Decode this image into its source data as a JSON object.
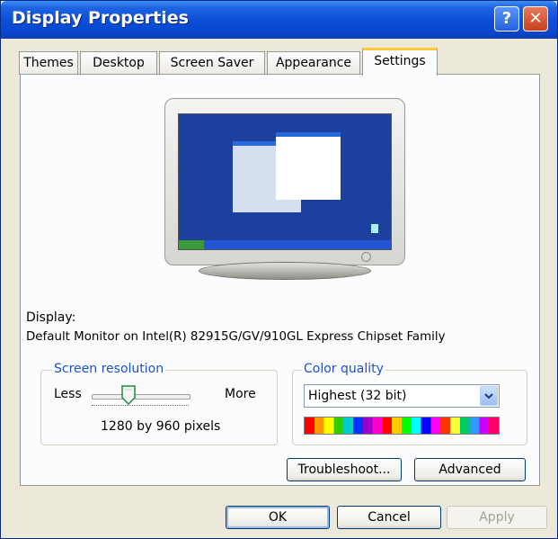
{
  "window": {
    "title": "Display Properties",
    "help_label": "?",
    "close_label": "✕"
  },
  "tabs": [
    {
      "label": "Themes"
    },
    {
      "label": "Desktop"
    },
    {
      "label": "Screen Saver"
    },
    {
      "label": "Appearance"
    },
    {
      "label": "Settings",
      "active": true
    }
  ],
  "settings": {
    "display_label": "Display:",
    "display_value": "Default Monitor on Intel(R) 82915G/GV/910GL Express Chipset Family",
    "screen_resolution": {
      "title": "Screen resolution",
      "less_label": "Less",
      "more_label": "More",
      "value": "1280 by 960 pixels",
      "slider_level": 0.38
    },
    "color_quality": {
      "title": "Color quality",
      "selected": "Highest (32 bit)",
      "swatch_colors": [
        "#ff0000",
        "#ff9900",
        "#ffff00",
        "#33cc00",
        "#00cccc",
        "#0033ff",
        "#9900cc",
        "#ff00cc",
        "#ff0000",
        "#ffcc00",
        "#00ff00",
        "#00ffff",
        "#0000ff",
        "#ff00ff",
        "#ff3300",
        "#ffff33",
        "#00cc66",
        "#3399ff",
        "#cc00ff",
        "#ff0066"
      ]
    },
    "troubleshoot_label": "Troubleshoot...",
    "advanced_label": "Advanced"
  },
  "footer": {
    "ok_label": "OK",
    "cancel_label": "Cancel",
    "apply_label": "Apply"
  },
  "colors": {
    "titlebar": "#0a47cf",
    "dialog_bg": "#ece9d8",
    "panel_bg": "#fcfcfe",
    "group_title": "#1b52c8",
    "desktop": "#1d3f9d"
  }
}
